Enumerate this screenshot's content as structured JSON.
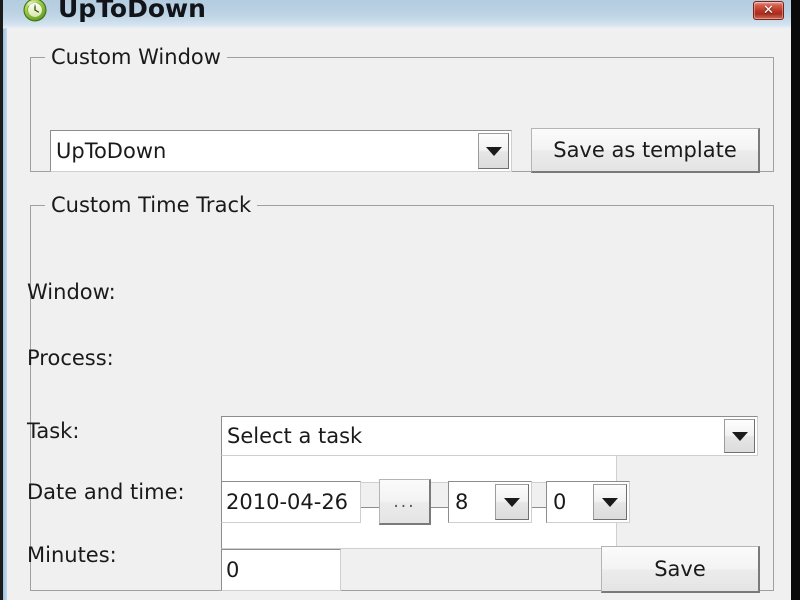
{
  "window": {
    "title": "UpToDown",
    "icon": "clock-icon",
    "close_label": "✕",
    "accent_titlebar": "#b9d1e2",
    "close_button_color": "#b93526"
  },
  "custom_window_group": {
    "legend": "Custom Window",
    "template_combo": {
      "value": "UpToDown",
      "arrow": "chevron-down-icon"
    },
    "save_as_template_label": "Save as template"
  },
  "custom_time_track_group": {
    "legend": "Custom Time Track",
    "fields": {
      "window": {
        "label": "Window:",
        "value": "",
        "placeholder": ""
      },
      "process": {
        "label": "Process:",
        "value": "",
        "placeholder": ""
      },
      "task": {
        "label": "Task:",
        "value": "Select a task",
        "arrow": "chevron-down-icon"
      },
      "datetime": {
        "label": "Date and time:",
        "date_value": "2010-04-26",
        "picker_label": "...",
        "hour_value": "8",
        "minute_value": "0"
      },
      "minutes": {
        "label": "Minutes:",
        "value": "0"
      }
    },
    "save_label": "Save"
  }
}
